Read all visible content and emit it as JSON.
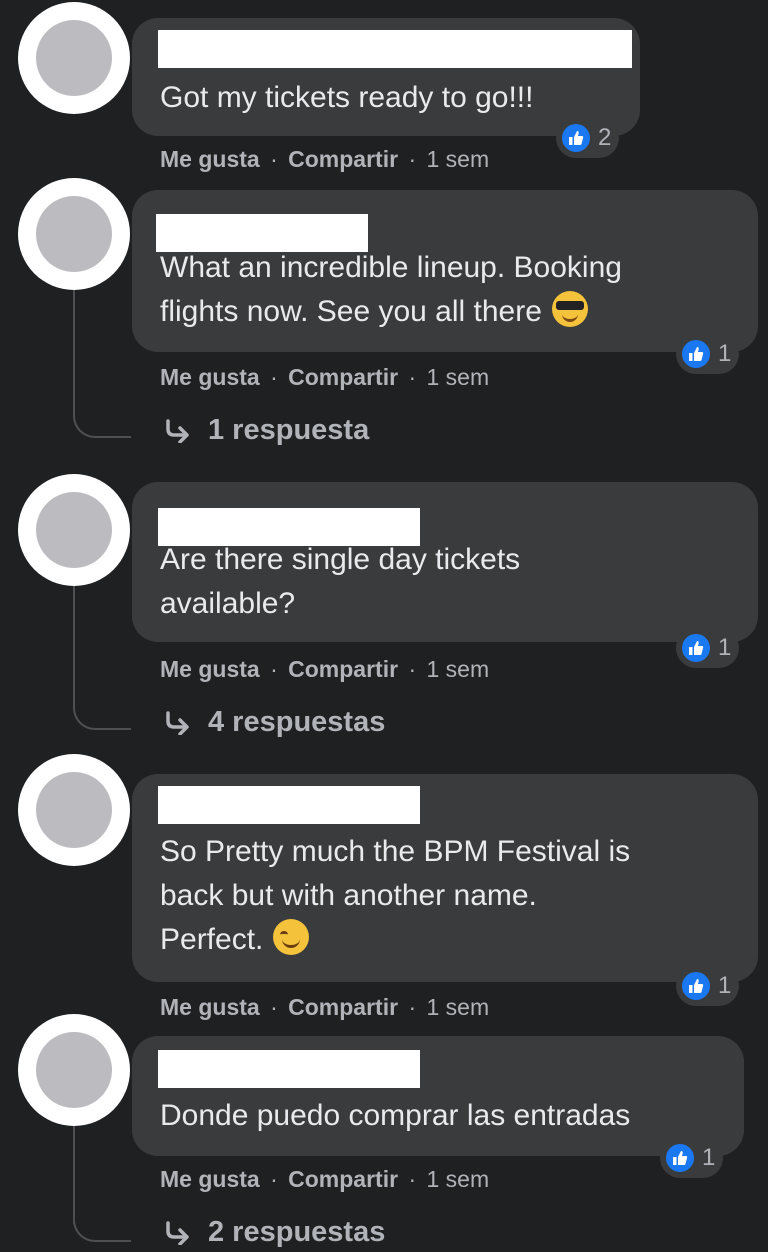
{
  "actions": {
    "like": "Me gusta",
    "share": "Compartir",
    "separator": "·",
    "time": "1 sem"
  },
  "comments": [
    {
      "lines": [
        "Got my tickets ready to go!!!"
      ],
      "emoji": "",
      "reactions": "2",
      "replies": ""
    },
    {
      "lines": [
        "What an incredible lineup. Booking",
        "flights now. See you all there"
      ],
      "emoji": "sunglasses-emoji",
      "reactions": "1",
      "replies": "1 respuesta"
    },
    {
      "lines": [
        "Are there single day tickets",
        "available?"
      ],
      "emoji": "",
      "reactions": "1",
      "replies": "4 respuestas"
    },
    {
      "lines": [
        "So Pretty much the BPM Festival is",
        "back but with another name.",
        "Perfect."
      ],
      "emoji": "smirk-emoji",
      "reactions": "1",
      "replies": ""
    },
    {
      "lines": [
        "Donde puedo comprar las entradas"
      ],
      "emoji": "",
      "reactions": "1",
      "replies": "2 respuestas"
    }
  ]
}
